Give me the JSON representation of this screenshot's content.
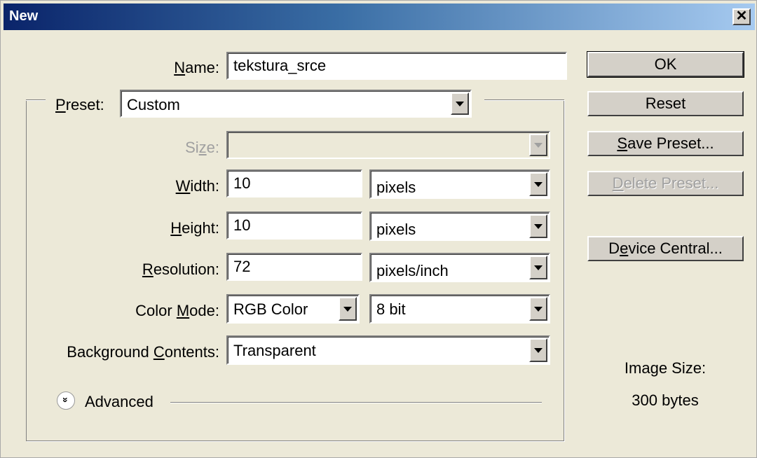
{
  "window": {
    "title": "New",
    "close_glyph": "✕"
  },
  "name": {
    "label_pre": "",
    "label_u": "N",
    "label_post": "ame:",
    "value": "tekstura_srce"
  },
  "preset": {
    "label_pre": "",
    "label_u": "P",
    "label_post": "reset:",
    "value": "Custom"
  },
  "size": {
    "label_pre": "Si",
    "label_u": "z",
    "label_post": "e:",
    "value": ""
  },
  "width": {
    "label_pre": "",
    "label_u": "W",
    "label_post": "idth:",
    "value": "10",
    "unit": "pixels"
  },
  "height": {
    "label_pre": "",
    "label_u": "H",
    "label_post": "eight:",
    "value": "10",
    "unit": "pixels"
  },
  "resolution": {
    "label_pre": "",
    "label_u": "R",
    "label_post": "esolution:",
    "value": "72",
    "unit": "pixels/inch"
  },
  "color_mode": {
    "label_pre": "Color ",
    "label_u": "M",
    "label_post": "ode:",
    "value": "RGB Color",
    "depth": "8 bit"
  },
  "background": {
    "label_pre": "Background ",
    "label_u": "C",
    "label_post": "ontents:",
    "value": "Transparent"
  },
  "advanced": {
    "label": "Advanced",
    "icon": "double-chevron-down-icon",
    "glyph": "»"
  },
  "buttons": {
    "ok": {
      "label_pre": "OK",
      "label_u": "",
      "label_post": ""
    },
    "reset": {
      "label_pre": "Reset",
      "label_u": "",
      "label_post": ""
    },
    "save_preset": {
      "label_pre": "",
      "label_u": "S",
      "label_post": "ave Preset..."
    },
    "delete_preset": {
      "label_pre": "",
      "label_u": "D",
      "label_post": "elete Preset..."
    },
    "device_central": {
      "label_pre": "D",
      "label_u": "e",
      "label_post": "vice Central..."
    }
  },
  "image_size": {
    "label": "Image Size:",
    "value": "300 bytes"
  },
  "colors": {
    "title_start": "#0a246a",
    "title_end": "#a6caf0",
    "dialog_bg": "#ece9d8",
    "button_face": "#d4d0c8",
    "disabled_text": "#a0a0a0"
  }
}
